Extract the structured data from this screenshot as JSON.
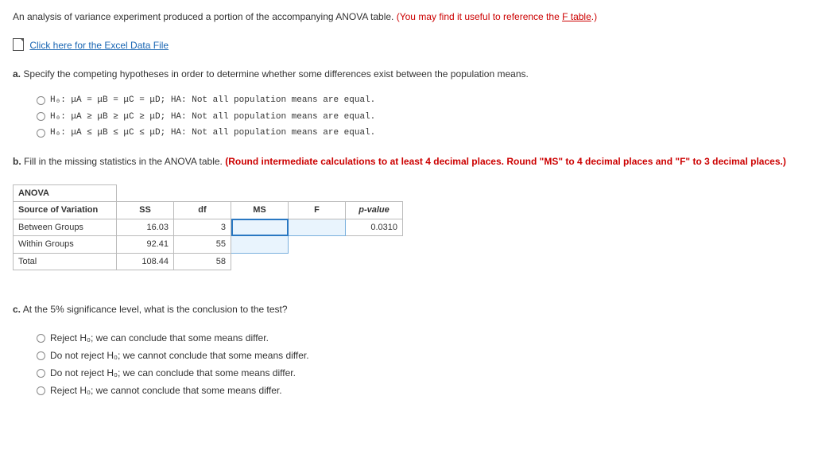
{
  "intro": {
    "text": "An analysis of variance experiment produced a portion of the accompanying ANOVA table. ",
    "hint1": "(You may find it useful to reference the ",
    "ftable_link": "F table",
    "hint2": ".)"
  },
  "excel_link": "Click here for the Excel Data File",
  "part_a": {
    "label": "a.",
    "text": " Specify the competing hypotheses in order to determine whether some differences exist between the population means.",
    "options": [
      "H₀: μA = μB = μC = μD; HA: Not all population means are equal.",
      "H₀: μA ≥ μB ≥ μC ≥ μD; HA: Not all population means are equal.",
      "H₀: μA ≤ μB ≤ μC ≤ μD; HA: Not all population means are equal."
    ]
  },
  "part_b": {
    "label": "b.",
    "text": " Fill in the missing statistics in the ANOVA table. ",
    "red_text": "(Round intermediate calculations to at least 4 decimal places. Round \"MS\" to 4 decimal places and \"F\" to 3 decimal places.)"
  },
  "anova": {
    "title": "ANOVA",
    "headers": [
      "Source of Variation",
      "SS",
      "df",
      "MS",
      "F",
      "p-value"
    ],
    "rows": [
      {
        "label": "Between Groups",
        "ss": "16.03",
        "df": "3",
        "ms": "",
        "f": "",
        "p": "0.0310"
      },
      {
        "label": "Within Groups",
        "ss": "92.41",
        "df": "55",
        "ms": "",
        "f": null,
        "p": null
      },
      {
        "label": "Total",
        "ss": "108.44",
        "df": "58",
        "ms": null,
        "f": null,
        "p": null
      }
    ]
  },
  "part_c": {
    "label": "c.",
    "text": " At the 5% significance level, what is the conclusion to the test?",
    "options": [
      "Reject H₀; we can conclude that some means differ.",
      "Do not reject H₀; we cannot conclude that some means differ.",
      "Do not reject H₀; we can conclude that some means differ.",
      "Reject H₀; we cannot conclude that some means differ."
    ]
  }
}
